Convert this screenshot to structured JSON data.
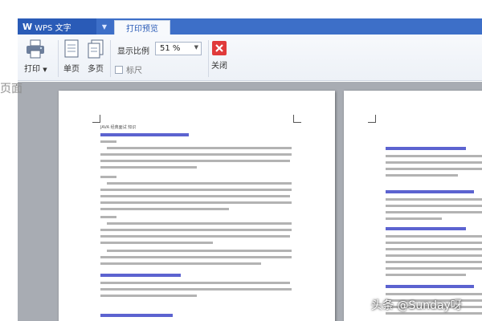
{
  "app": {
    "name": "WPS 文字"
  },
  "tabs": [
    {
      "label": "打印预览",
      "active": true
    }
  ],
  "toolbar": {
    "print_label": "打印",
    "single_page_label": "单页",
    "multi_page_label": "多页",
    "zoom_label": "显示比例",
    "zoom_value": "51 %",
    "ruler_label": "标尺",
    "close_label": "关闭"
  },
  "document": {
    "side_fragment": "页面",
    "page1_header": "JAVA 经典面试 知识"
  },
  "watermark": "头条 @Sunday呀",
  "colors": {
    "titlebar": "#3d6fc8",
    "accent": "#2a5bb7",
    "close": "#e03a3a",
    "canvas": "#a8acb3"
  }
}
